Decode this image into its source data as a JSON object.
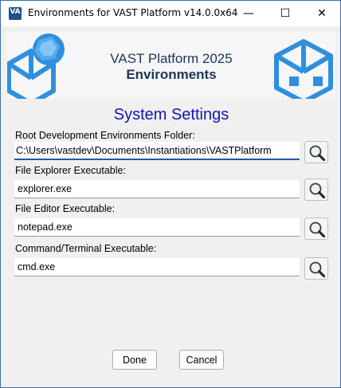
{
  "window": {
    "title": "Environments for VAST Platform v14.0.0x64",
    "icon_text": "VA",
    "minimize_glyph": "—",
    "maximize_glyph": "☐",
    "close_glyph": "✕"
  },
  "banner": {
    "title": "VAST Platform 2025",
    "subtitle": "Environments"
  },
  "heading": "System Settings",
  "fields": [
    {
      "label": "Root Development Environments Folder:",
      "value": "C:\\Users\\vastdev\\Documents\\Instantiations\\VASTPlatform",
      "button_icon": "magnifier-icon"
    },
    {
      "label": "File Explorer Executable:",
      "value": "explorer.exe",
      "button_icon": "magnifier-icon"
    },
    {
      "label": "File Editor Executable:",
      "value": "notepad.exe",
      "button_icon": "magnifier-icon"
    },
    {
      "label": "Command/Terminal Executable:",
      "value": "cmd.exe",
      "button_icon": "magnifier-icon"
    }
  ],
  "buttons": {
    "done": "Done",
    "cancel": "Cancel"
  },
  "colors": {
    "heading": "#1414b4",
    "banner_text": "#1d3557",
    "focus_underline": "#1e5aa8",
    "cube_blue": "#2f8fde"
  }
}
